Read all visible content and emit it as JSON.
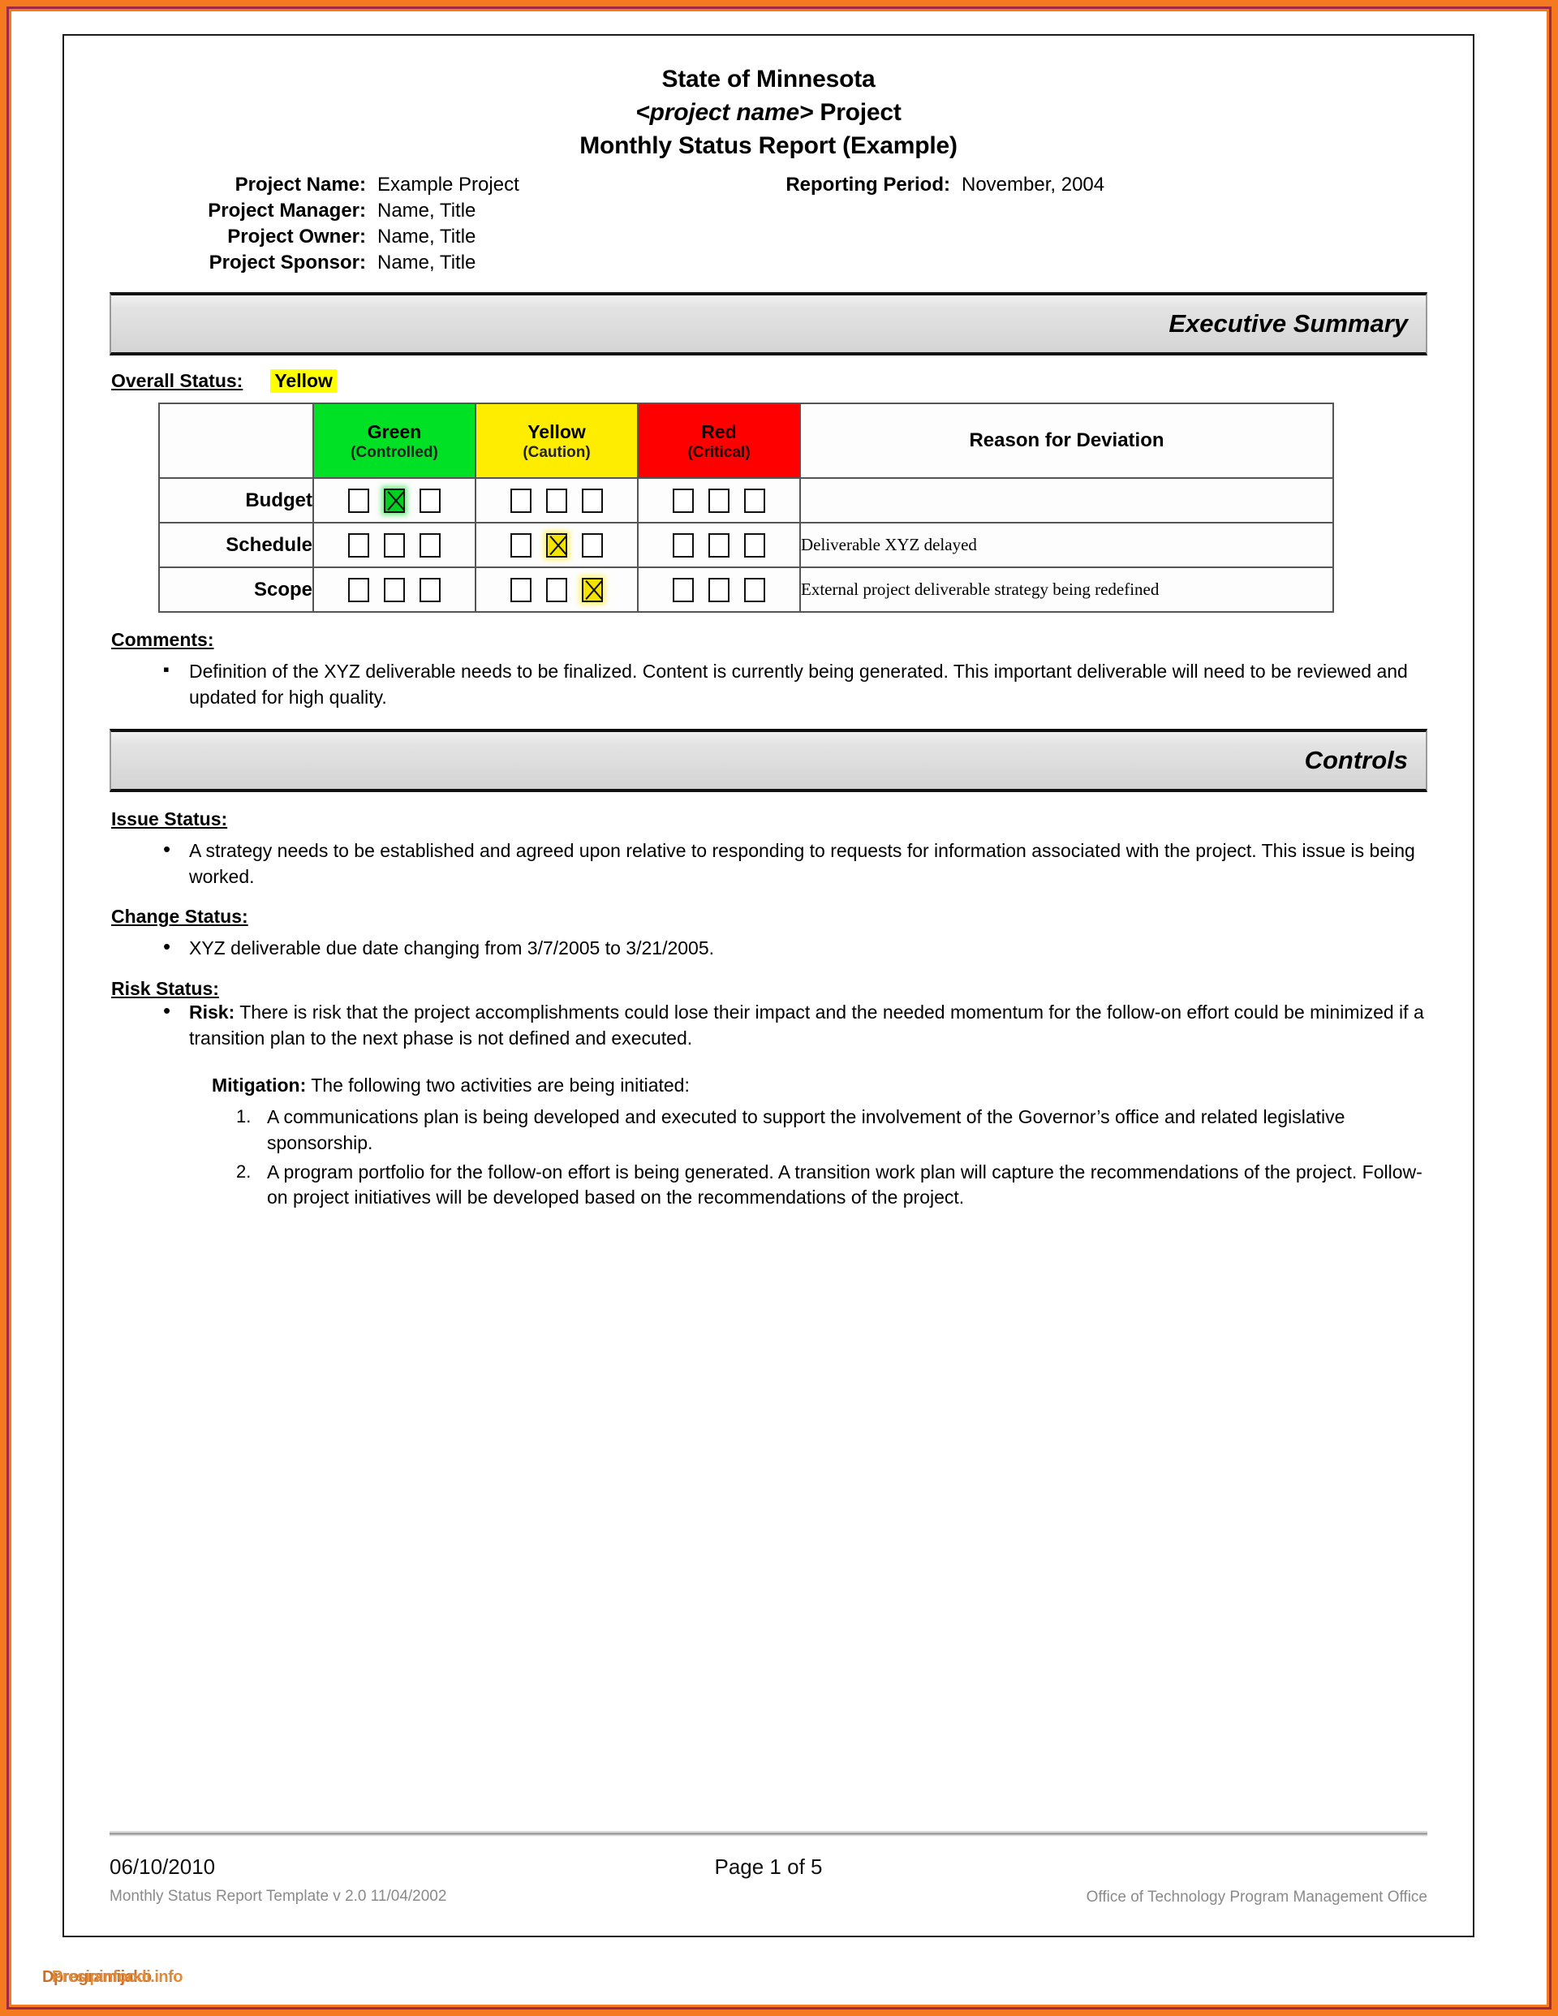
{
  "document": {
    "title_lines": [
      "State of Minnesota",
      "<project name> Project",
      "Monthly Status Report (Example)"
    ],
    "title_italic_part": "<project name>",
    "title_italic_rest": " Project"
  },
  "meta": {
    "project_name_label": "Project Name:",
    "project_name_value": "Example Project",
    "reporting_period_label": "Reporting Period:",
    "reporting_period_value": "November, 2004",
    "project_manager_label": "Project Manager:",
    "project_manager_value": "Name, Title",
    "project_owner_label": "Project Owner:",
    "project_owner_value": "Name, Title",
    "project_sponsor_label": "Project Sponsor:",
    "project_sponsor_value": "Name, Title"
  },
  "executive_summary": {
    "banner_label": "Executive Summary",
    "overall_status_label": "Overall Status:",
    "overall_status_value": "Yellow",
    "overall_status_color": "#FFFF00"
  },
  "status_matrix": {
    "headers": {
      "blank": "",
      "green_title": "Green",
      "green_sub": "(Controlled)",
      "yellow_title": "Yellow",
      "yellow_sub": "(Caution)",
      "red_title": "Red",
      "red_sub": "(Critical)",
      "reason": "Reason for Deviation"
    },
    "colors": {
      "green": "#00E025",
      "yellow": "#FFED00",
      "red": "#FF0000"
    },
    "rows": [
      {
        "label": "Budget",
        "green": [
          false,
          true,
          false
        ],
        "yellow": [
          false,
          false,
          false
        ],
        "red": [
          false,
          false,
          false
        ],
        "reason": ""
      },
      {
        "label": "Schedule",
        "green": [
          false,
          false,
          false
        ],
        "yellow": [
          false,
          true,
          false
        ],
        "red": [
          false,
          false,
          false
        ],
        "reason": "Deliverable XYZ delayed"
      },
      {
        "label": "Scope",
        "green": [
          false,
          false,
          false
        ],
        "yellow": [
          false,
          false,
          true
        ],
        "red": [
          false,
          false,
          false
        ],
        "reason": "External project deliverable strategy being redefined"
      }
    ]
  },
  "comments": {
    "heading": "Comments:",
    "items": [
      "Definition of the XYZ deliverable needs to be finalized.  Content is currently being generated.  This important deliverable will need to be reviewed and updated for high quality."
    ]
  },
  "controls": {
    "banner_label": "Controls",
    "issue_status": {
      "heading": "Issue Status:",
      "items": [
        "A strategy needs to be established and agreed upon relative to responding to requests for information associated with the project.  This issue is being worked."
      ]
    },
    "change_status": {
      "heading": "Change Status:",
      "items": [
        "XYZ deliverable due date changing from 3/7/2005 to 3/21/2005."
      ]
    },
    "risk_status": {
      "heading": "Risk Status:",
      "risk_label": "Risk:",
      "risk_text": " There is risk that the project accomplishments could lose their impact and the needed momentum for the follow-on effort could be minimized if a transition plan to the next phase is not defined and executed.",
      "mitigation_label": "Mitigation:",
      "mitigation_text": "  The following two activities are being initiated:",
      "mitigation_items": [
        "A communications plan is being developed and executed to support the involvement of the Governor’s office and related legislative sponsorship.",
        "A program portfolio for the follow-on effort is being generated. A transition work plan will capture the recommendations of the project. Follow-on project initiatives will be developed based on the recommendations of the project."
      ]
    }
  },
  "footer": {
    "date": "06/10/2010",
    "template_line": "Monthly Status Report Template  v 2.0  11/04/2002",
    "page": "Page 1 of 5",
    "office": "Office of Technology Program Management Office"
  },
  "watermark": {
    "text_a": "Dprogramijako",
    "text_b": "Presipinfoodi.info"
  }
}
